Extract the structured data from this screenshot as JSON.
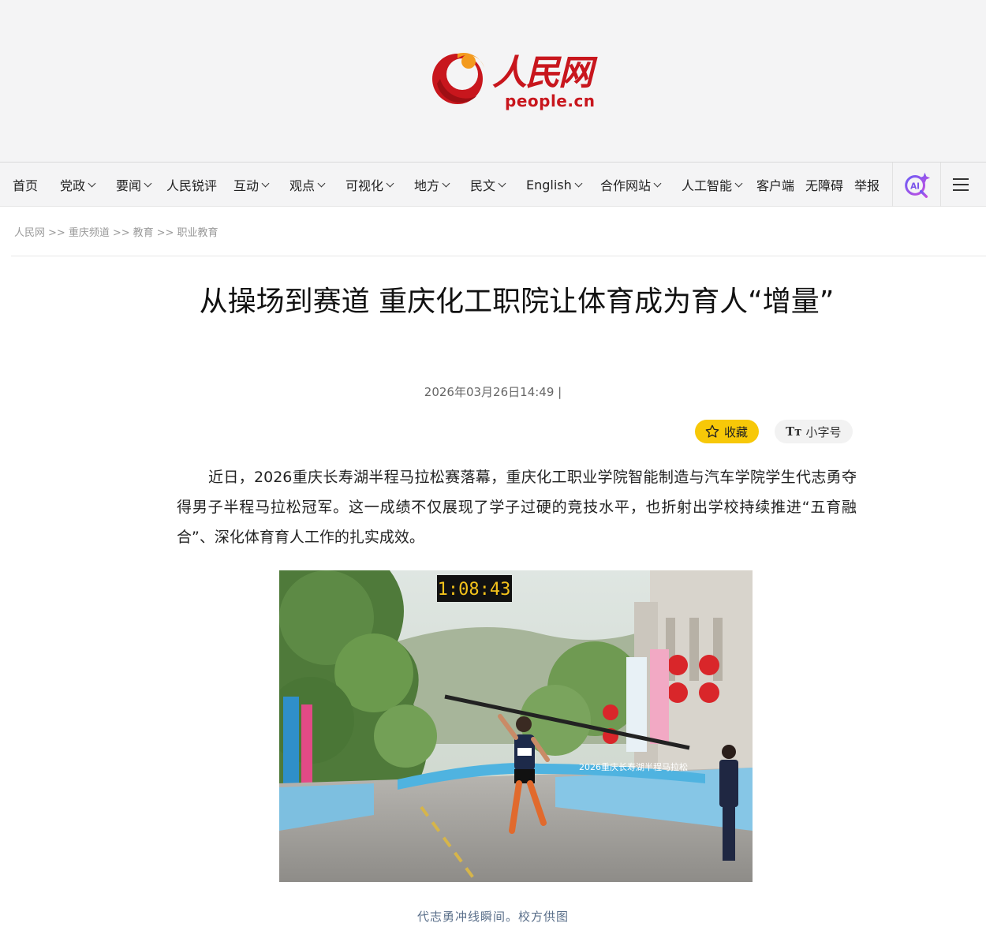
{
  "brand": {
    "name_cn": "人民网",
    "domain": "people.cn",
    "color": "#c8161d"
  },
  "nav": {
    "items": [
      {
        "label": "首页",
        "dropdown": false
      },
      {
        "label": "党政",
        "dropdown": true
      },
      {
        "label": "要闻",
        "dropdown": true
      },
      {
        "label": "人民锐评",
        "dropdown": false
      },
      {
        "label": "互动",
        "dropdown": true
      },
      {
        "label": "观点",
        "dropdown": true
      },
      {
        "label": "可视化",
        "dropdown": true
      },
      {
        "label": "地方",
        "dropdown": true
      },
      {
        "label": "民文",
        "dropdown": true
      },
      {
        "label": "English",
        "dropdown": true
      },
      {
        "label": "合作网站",
        "dropdown": true
      },
      {
        "label": "人工智能",
        "dropdown": true
      },
      {
        "label": "客户端",
        "dropdown": false
      },
      {
        "label": "无障碍",
        "dropdown": false
      },
      {
        "label": "举报",
        "dropdown": false
      }
    ],
    "ai_icon": "ai-sparkle-icon",
    "menu_icon": "hamburger-menu-icon"
  },
  "breadcrumb": {
    "items": [
      "人民网",
      "重庆频道",
      "教育",
      "职业教育"
    ],
    "separator": ">>"
  },
  "article": {
    "title": "从操场到赛道 重庆化工职院让体育成为育人“增量”",
    "date": "2026年03月26日14:49 |",
    "collect_label": "收藏",
    "font_label": "小字号",
    "font_icon_text": "Tт",
    "body": "近日，2026重庆长寿湖半程马拉松赛落幕，重庆化工职业学院智能制造与汽车学院学生代志勇夺得男子半程马拉松冠军。这一成绩不仅展现了学子过硬的竞技水平，也折射出学校持续推进“五育融合”、深化体育育人工作的扎实成效。",
    "photo": {
      "timer": "1:08:43",
      "banner_text": "2026重庆长寿湖半程马拉松"
    },
    "caption": "代志勇冲线瞬间。校方供图"
  }
}
